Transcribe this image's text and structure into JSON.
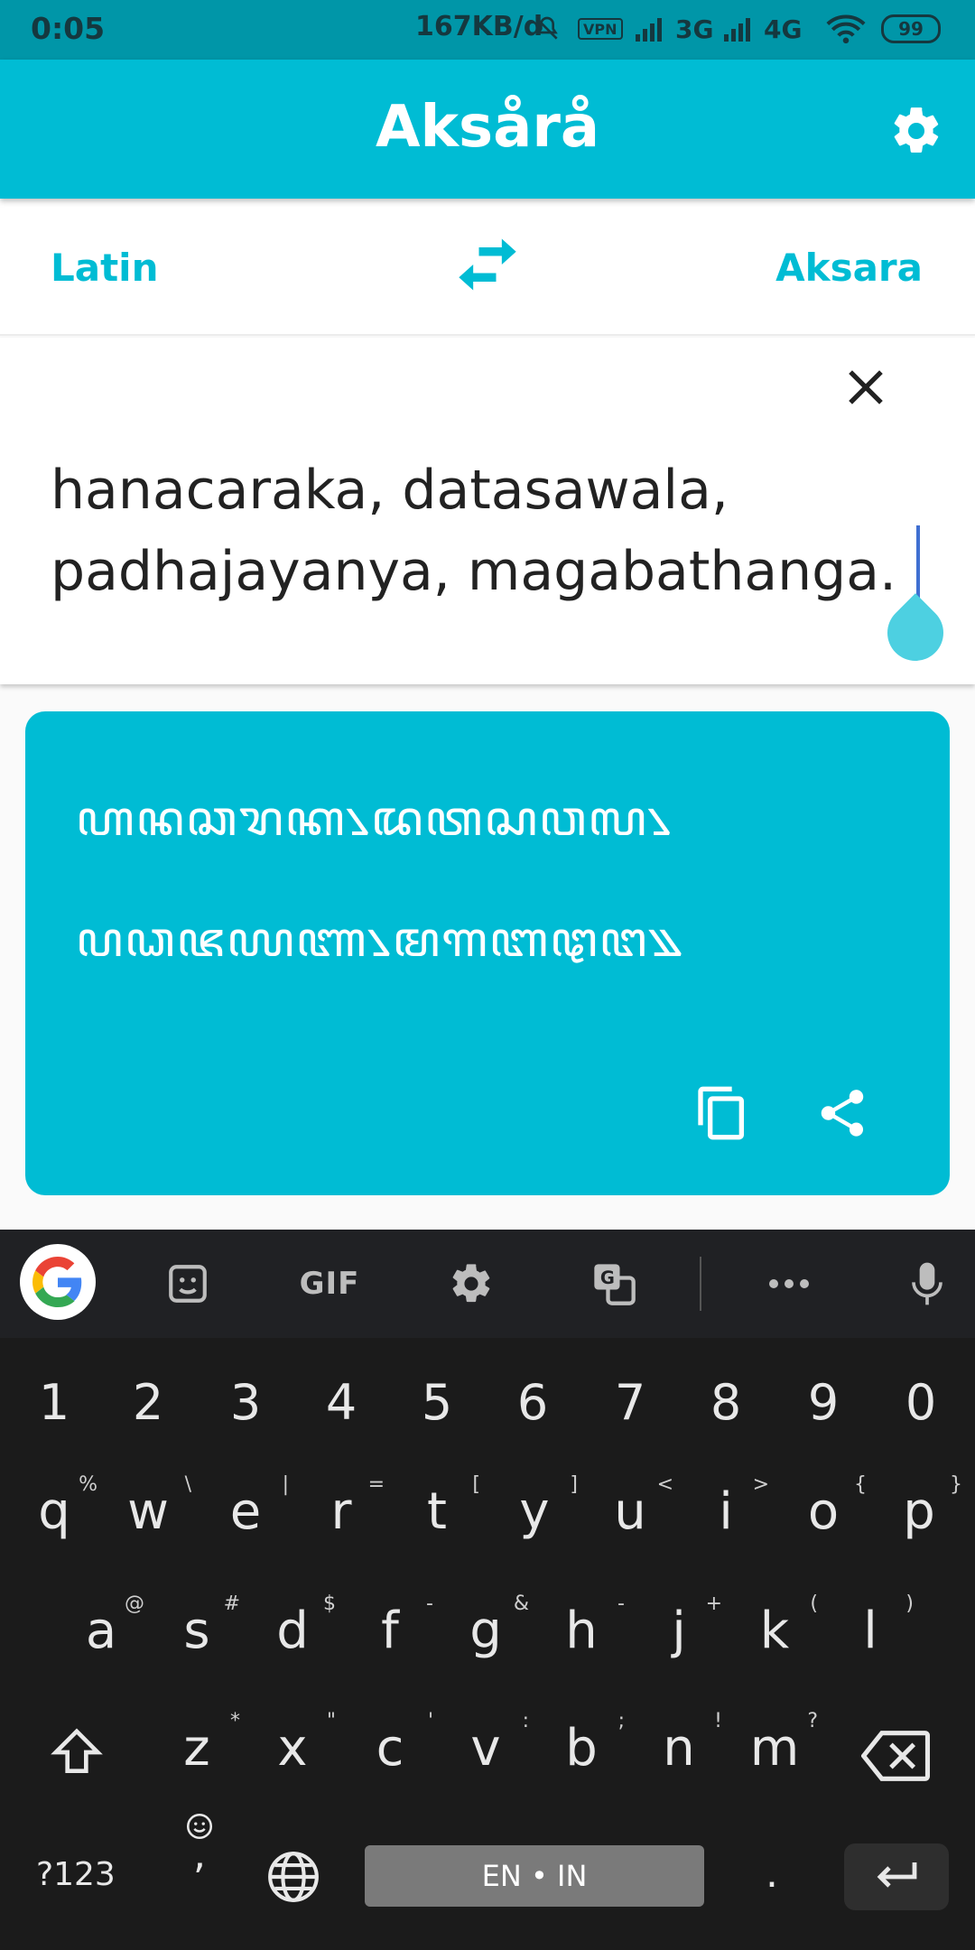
{
  "status_bar": {
    "time": "0:05",
    "speed": "167KB/d",
    "vpn": "VPN",
    "net1": "3G",
    "net2": "4G",
    "battery": "99"
  },
  "app_bar": {
    "title": "Aksårå",
    "settings_icon": "gear-icon"
  },
  "language_row": {
    "source": "Latin",
    "target": "Aksara",
    "swap_icon": "swap-arrows-icon"
  },
  "input": {
    "text": "hanacaraka, datasawala,\npadhajayanya, magabathanga."
  },
  "output": {
    "line1": "ꦲꦤꦕꦫꦏ꧈ꦢꦠꦱꦮꦭ꧈",
    "line2": "ꦥꦣꦗꦪꦚ꧈ꦩꦒꦧꦛꦔ꧉"
  },
  "keyboard": {
    "toolbar": [
      "google-icon",
      "sticker-icon",
      "GIF",
      "gear-icon",
      "translate-icon",
      "more-icon",
      "mic-icon"
    ],
    "gif_label": "GIF",
    "numbers": [
      "1",
      "2",
      "3",
      "4",
      "5",
      "6",
      "7",
      "8",
      "9",
      "0"
    ],
    "row1": [
      {
        "k": "q",
        "h": "%"
      },
      {
        "k": "w",
        "h": "\\"
      },
      {
        "k": "e",
        "h": "|"
      },
      {
        "k": "r",
        "h": "="
      },
      {
        "k": "t",
        "h": "["
      },
      {
        "k": "y",
        "h": "]"
      },
      {
        "k": "u",
        "h": "<"
      },
      {
        "k": "i",
        "h": ">"
      },
      {
        "k": "o",
        "h": "{"
      },
      {
        "k": "p",
        "h": "}"
      }
    ],
    "row2": [
      {
        "k": "a",
        "h": "@"
      },
      {
        "k": "s",
        "h": "#"
      },
      {
        "k": "d",
        "h": "$"
      },
      {
        "k": "f",
        "h": "-"
      },
      {
        "k": "g",
        "h": "&"
      },
      {
        "k": "h",
        "h": "-"
      },
      {
        "k": "j",
        "h": "+"
      },
      {
        "k": "k",
        "h": "("
      },
      {
        "k": "l",
        "h": ")"
      }
    ],
    "row3": [
      {
        "k": "z",
        "h": "*"
      },
      {
        "k": "x",
        "h": "\""
      },
      {
        "k": "c",
        "h": "'"
      },
      {
        "k": "v",
        "h": ":"
      },
      {
        "k": "b",
        "h": ";"
      },
      {
        "k": "n",
        "h": "!"
      },
      {
        "k": "m",
        "h": "?"
      }
    ],
    "symbols": "?123",
    "comma": ",",
    "space_label": "EN • IN",
    "period": "."
  },
  "colors": {
    "accent": "#00bcd4",
    "status_bar": "#0096a8",
    "keyboard_bg": "#1b1b1b"
  }
}
